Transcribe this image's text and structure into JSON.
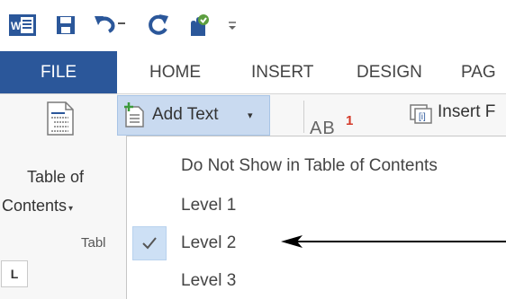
{
  "quick_access": {
    "word_icon": "word-app-icon",
    "save_icon": "save-icon",
    "undo_icon": "undo-icon",
    "undo_dropdown_icon": "caret-down-icon",
    "redo_icon": "repeat-icon",
    "touch_icon": "touch-mode-icon",
    "customize_icon": "customize-qat-icon"
  },
  "tabs": [
    {
      "label": "FILE"
    },
    {
      "label": "HOME"
    },
    {
      "label": "INSERT"
    },
    {
      "label": "DESIGN"
    },
    {
      "label": "PAG"
    }
  ],
  "ribbon": {
    "toc_button": {
      "line1": "Table of",
      "line2": "Contents",
      "caret": "▾"
    },
    "group_label": "Tabl",
    "add_text": {
      "label": "Add Text",
      "caret": "▾"
    },
    "footnote": {
      "letters": "AB",
      "superscript": "1"
    },
    "insert_button": {
      "label": "Insert F"
    }
  },
  "ruler": {
    "tab_selector": "L"
  },
  "dropdown": {
    "items": [
      {
        "label": "Do Not Show in Table of Contents",
        "checked": false
      },
      {
        "label": "Level 1",
        "checked": false
      },
      {
        "label": "Level 2",
        "checked": true
      },
      {
        "label": "Level 3",
        "checked": false
      }
    ],
    "check_glyph": "✓"
  },
  "colors": {
    "file_tab": "#2b579a",
    "highlight": "#c9daf0",
    "word_blue": "#2b579a",
    "accent_red": "#d43a2a"
  }
}
